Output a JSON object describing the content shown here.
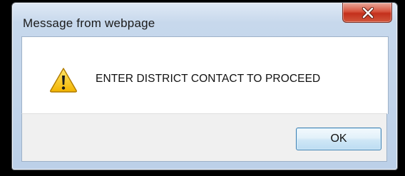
{
  "dialog": {
    "title": "Message from webpage",
    "message": "ENTER DISTRICT CONTACT TO PROCEED",
    "ok_label": "OK",
    "icon": "warning-icon",
    "close_icon": "close-icon"
  },
  "colors": {
    "close_button": "#c3301c",
    "warning_fill": "#f5c400",
    "ok_border": "#3c7fb1"
  }
}
